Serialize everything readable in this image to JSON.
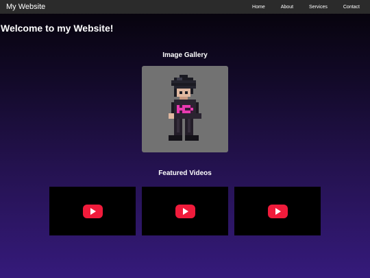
{
  "header": {
    "site_title": "My Website",
    "nav": [
      {
        "label": "Home"
      },
      {
        "label": "About"
      },
      {
        "label": "Services"
      },
      {
        "label": "Contact"
      }
    ]
  },
  "main": {
    "welcome": "Welcome to my Website!",
    "gallery": {
      "title": "Image Gallery",
      "image_icon": "pixel-art-character-icon"
    },
    "videos": {
      "title": "Featured Videos",
      "play_icon": "youtube-play-icon",
      "items": [
        {},
        {},
        {}
      ]
    }
  },
  "colors": {
    "navbar": "#2b2b2b",
    "gallery_frame": "#727272",
    "video_bg": "#000000",
    "play_button": "#f01b3b",
    "gradient_top": "#050208",
    "gradient_bottom": "#351a7b"
  }
}
